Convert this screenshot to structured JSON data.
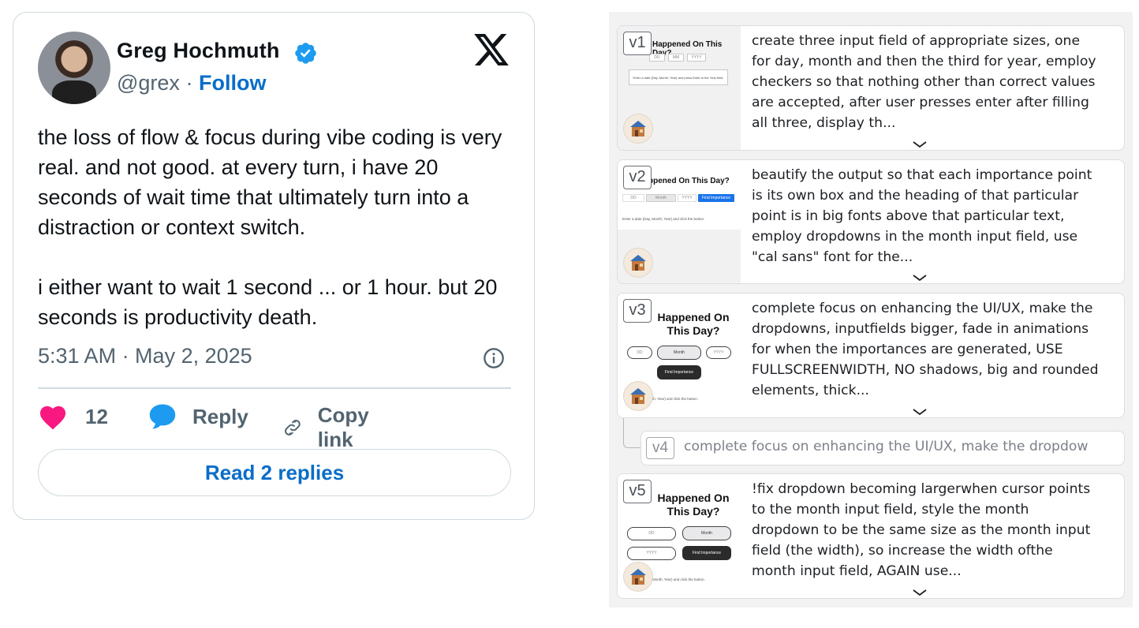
{
  "tweet": {
    "display_name": "Greg Hochmuth",
    "handle": "@grex",
    "separator": "·",
    "follow_label": "Follow",
    "paragraphs": [
      "the loss of flow & focus during vibe coding is very real. and not good. at every turn, i have 20 seconds of wait time that ultimately turn into a distraction or context switch.",
      "i either want to wait 1 second ... or 1 hour. but 20 seconds is productivity death."
    ],
    "timestamp": "5:31 AM · May 2, 2025",
    "like_count": "12",
    "reply_label": "Reply",
    "copy_link_label": "Copy link",
    "read_replies_label": "Read 2 replies",
    "colors": {
      "link": "#0a6dc9",
      "heart": "#f91880",
      "reply_icon": "#1d9bf0",
      "verified": "#1d9bf0"
    },
    "icons": [
      "verified-badge-icon",
      "x-logo-icon",
      "info-icon",
      "heart-icon",
      "reply-bubble-icon",
      "link-icon"
    ]
  },
  "versions": {
    "items": [
      {
        "badge": "v1",
        "thumb_title": "Happened On This Day?",
        "thumb_fields": [
          "DD",
          "MM",
          "YYYY"
        ],
        "thumb_note": "Enter a date (Day, Month, Year) and press Enter in the Year field.",
        "text": "create three input field of appropriate sizes, one for day, month and then the third for year, employ checkers so that nothing other than correct values are accepted, after user presses enter after filling all three, display th..."
      },
      {
        "badge": "v2",
        "thumb_title": "ppened On This Day?",
        "thumb_fields": [
          "DD",
          "Month",
          "YYYY"
        ],
        "thumb_button": "Find Importance",
        "thumb_note": "Enter a date (Day, Month, Year) and click the button.",
        "text": "beautify the output so that each importance point is its own box and the heading of that particular point is in big fonts above that particular text, employ dropdowns in the month input field, use \"cal sans\" font for the..."
      },
      {
        "badge": "v3",
        "thumb_title": "Happened On This Day?",
        "thumb_fields": [
          "DD",
          "Month",
          "YYYY"
        ],
        "thumb_button": "Find Importance",
        "thumb_note": "th, Year) and click the button.",
        "text": "complete focus on enhancing the UI/UX, make the dropdowns, inputfields bigger, fade in animations for when the importances are generated, USE FULLSCREENWIDTH, NO shadows, big and rounded elements, thick..."
      },
      {
        "badge": "v4",
        "text": "complete focus on enhancing the UI/UX, make the dropdow"
      },
      {
        "badge": "v5",
        "thumb_title": "Happened On This Day?",
        "thumb_fields": [
          "DD",
          "Month",
          "YYYY"
        ],
        "thumb_button": "Find Importance",
        "thumb_note": "Month, Year) and click the button.",
        "text": "!fix dropdown becoming largerwhen cursor points to the month input field, style the month dropdown to be the same size as the month input field (the width), so increase the width ofthe month input field, AGAIN use..."
      }
    ]
  }
}
